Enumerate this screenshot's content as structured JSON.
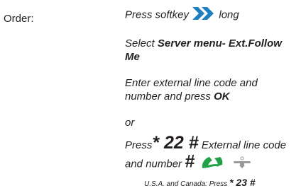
{
  "order_label": "Order:",
  "steps": {
    "softkey_prefix": "Press softkey",
    "softkey_suffix": "long",
    "select_prefix": "Select",
    "select_bold_1": "Server menu- Ext.Follow",
    "select_bold_2": "Me",
    "enter_line_1": "Enter external line code and",
    "enter_line_2_prefix": "number and press",
    "enter_ok": "OK",
    "or": "or",
    "press": "Press",
    "code": "* 22 #",
    "external_text": "External line code",
    "and_number": "and number",
    "hash": "#"
  },
  "note": {
    "text": "U.S.A. and Canada: Press",
    "code": "* 23 #"
  },
  "icons": {
    "softkey": "double-chevron-right-icon",
    "offhook": "handset-offhook-icon",
    "onhook": "handset-onhook-icon"
  },
  "colors": {
    "text": "#231f20",
    "softkey_blue": "#1e7fc0",
    "handset_green": "#21a147",
    "handset_grey": "#9a9a9a"
  }
}
